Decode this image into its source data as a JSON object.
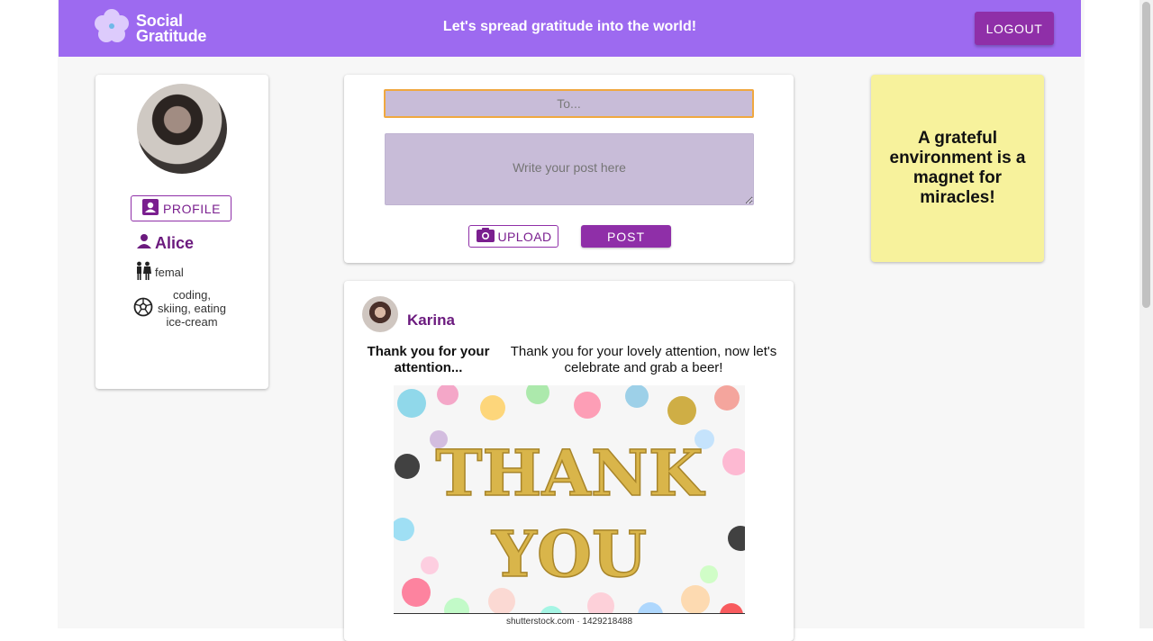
{
  "header": {
    "brand_line1": "Social",
    "brand_line2": "Gratitude",
    "tagline": "Let's spread gratitude into the world!",
    "logout_label": "LOGOUT",
    "color": "#9d6af0"
  },
  "profile": {
    "button_label": "PROFILE",
    "name": "Alice",
    "gender": "femal",
    "hobbies": "coding, skiing, eating ice-cream"
  },
  "composer": {
    "to_value": "To...",
    "post_placeholder": "Write your post here",
    "upload_label": "UPLOAD",
    "post_label": "POST"
  },
  "note": {
    "text": "A grateful environment is a magnet for miracles!"
  },
  "feed": {
    "author": "Karina",
    "title": "Thank you for your attention...",
    "body": "Thank you for your lovely attention, now let's celebrate and grab a beer!",
    "image_text_line1": "THANK",
    "image_text_line2": "YOU",
    "image_watermark": "shutterstock.com · 1429218488"
  },
  "colors": {
    "accent": "#8f2fa8",
    "note_bg": "#f7f29c",
    "input_bg": "#c8bcd8"
  }
}
